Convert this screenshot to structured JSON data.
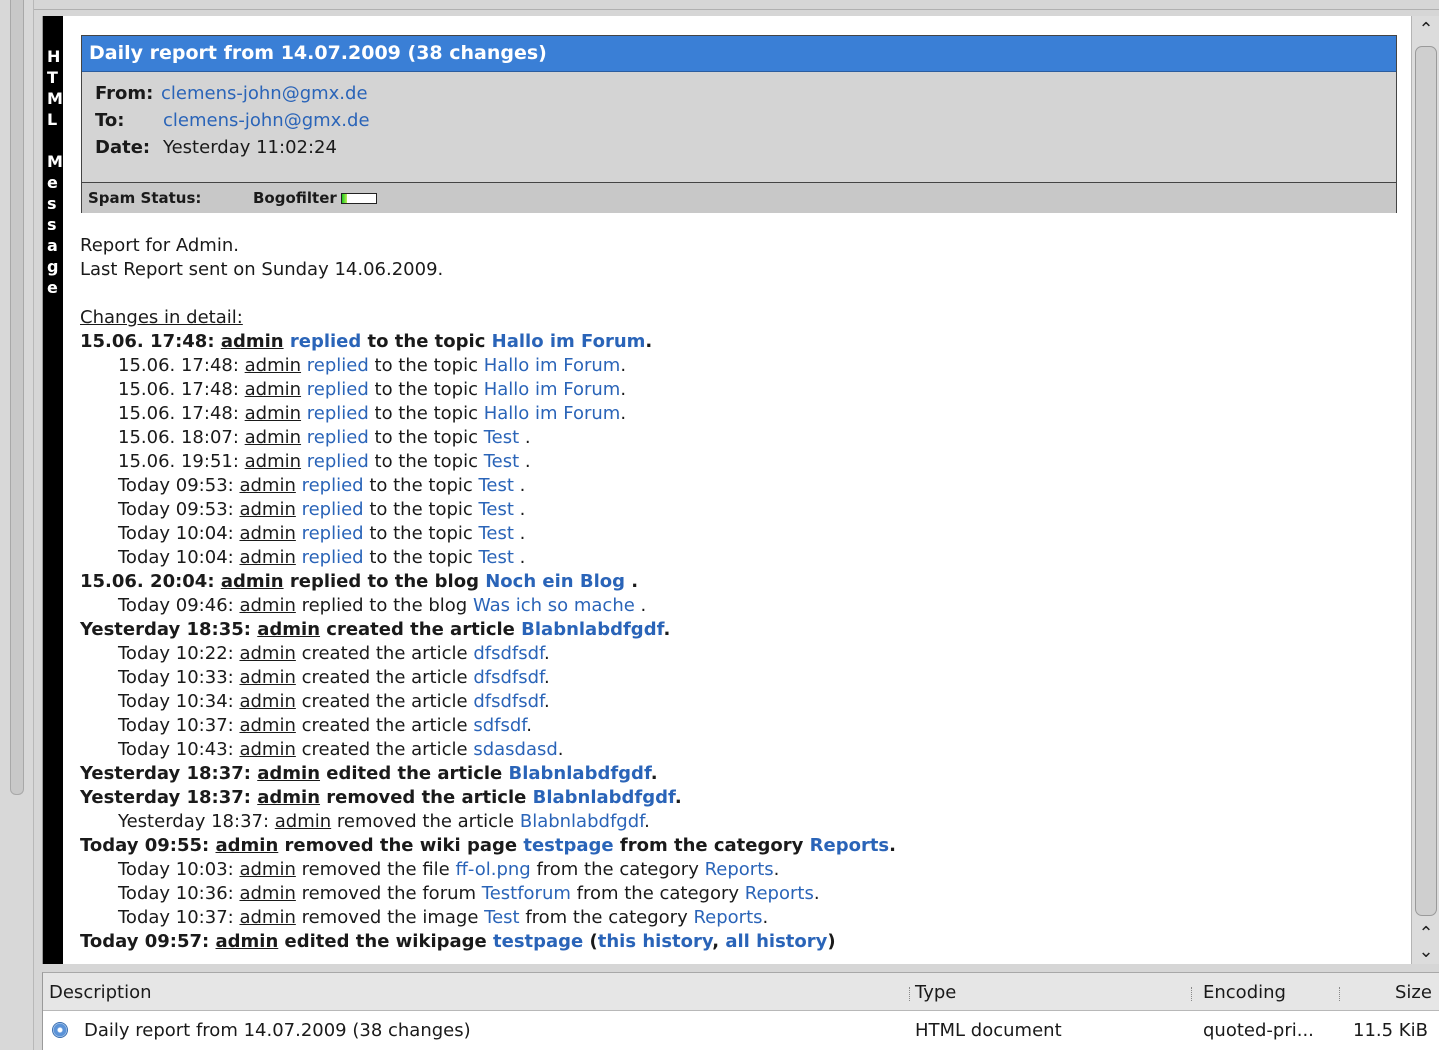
{
  "sidebar_label": "HTML Message",
  "header": {
    "title": "Daily report from 14.07.2009 (38 changes)",
    "from_label": "From:",
    "from_value": "clemens-john@gmx.de",
    "to_label": "To:",
    "to_value": "clemens-john@gmx.de",
    "date_label": "Date:",
    "date_value": "Yesterday 11:02:24",
    "spam_label": "Spam Status:",
    "spam_filter": "Bogofilter",
    "spam_level": 0.15
  },
  "body": {
    "line1": "Report for Admin.",
    "line2": "Last Report sent on Sunday 14.06.2009.",
    "changes_heading": "Changes in detail:"
  },
  "entries": [
    {
      "level": "main",
      "parts": [
        [
          "t",
          "15.06. 17:48: "
        ],
        [
          "u",
          "admin"
        ],
        [
          "t",
          " "
        ],
        [
          "l",
          "replied"
        ],
        [
          "t",
          " to the topic "
        ],
        [
          "l",
          "Hallo im Forum"
        ],
        [
          "t",
          "."
        ]
      ]
    },
    {
      "level": "sub",
      "parts": [
        [
          "t",
          "15.06. 17:48: "
        ],
        [
          "u",
          "admin"
        ],
        [
          "t",
          " "
        ],
        [
          "l",
          "replied"
        ],
        [
          "t",
          " to the topic "
        ],
        [
          "l",
          "Hallo im Forum"
        ],
        [
          "t",
          "."
        ]
      ]
    },
    {
      "level": "sub",
      "parts": [
        [
          "t",
          "15.06. 17:48: "
        ],
        [
          "u",
          "admin"
        ],
        [
          "t",
          " "
        ],
        [
          "l",
          "replied"
        ],
        [
          "t",
          " to the topic "
        ],
        [
          "l",
          "Hallo im Forum"
        ],
        [
          "t",
          "."
        ]
      ]
    },
    {
      "level": "sub",
      "parts": [
        [
          "t",
          "15.06. 17:48: "
        ],
        [
          "u",
          "admin"
        ],
        [
          "t",
          " "
        ],
        [
          "l",
          "replied"
        ],
        [
          "t",
          " to the topic "
        ],
        [
          "l",
          "Hallo im Forum"
        ],
        [
          "t",
          "."
        ]
      ]
    },
    {
      "level": "sub",
      "parts": [
        [
          "t",
          "15.06. 18:07: "
        ],
        [
          "u",
          "admin"
        ],
        [
          "t",
          " "
        ],
        [
          "l",
          "replied"
        ],
        [
          "t",
          " to the topic "
        ],
        [
          "l",
          "Test"
        ],
        [
          "t",
          " ."
        ]
      ]
    },
    {
      "level": "sub",
      "parts": [
        [
          "t",
          "15.06. 19:51: "
        ],
        [
          "u",
          "admin"
        ],
        [
          "t",
          " "
        ],
        [
          "l",
          "replied"
        ],
        [
          "t",
          " to the topic "
        ],
        [
          "l",
          "Test"
        ],
        [
          "t",
          " ."
        ]
      ]
    },
    {
      "level": "sub",
      "parts": [
        [
          "t",
          "Today 09:53: "
        ],
        [
          "u",
          "admin"
        ],
        [
          "t",
          " "
        ],
        [
          "l",
          "replied"
        ],
        [
          "t",
          " to the topic "
        ],
        [
          "l",
          "Test"
        ],
        [
          "t",
          " ."
        ]
      ]
    },
    {
      "level": "sub",
      "parts": [
        [
          "t",
          "Today 09:53: "
        ],
        [
          "u",
          "admin"
        ],
        [
          "t",
          " "
        ],
        [
          "l",
          "replied"
        ],
        [
          "t",
          " to the topic "
        ],
        [
          "l",
          "Test"
        ],
        [
          "t",
          " ."
        ]
      ]
    },
    {
      "level": "sub",
      "parts": [
        [
          "t",
          "Today 10:04: "
        ],
        [
          "u",
          "admin"
        ],
        [
          "t",
          " "
        ],
        [
          "l",
          "replied"
        ],
        [
          "t",
          " to the topic "
        ],
        [
          "l",
          "Test"
        ],
        [
          "t",
          " ."
        ]
      ]
    },
    {
      "level": "sub",
      "parts": [
        [
          "t",
          "Today 10:04: "
        ],
        [
          "u",
          "admin"
        ],
        [
          "t",
          " "
        ],
        [
          "l",
          "replied"
        ],
        [
          "t",
          " to the topic "
        ],
        [
          "l",
          "Test"
        ],
        [
          "t",
          " ."
        ]
      ]
    },
    {
      "level": "main",
      "parts": [
        [
          "t",
          "15.06. 20:04: "
        ],
        [
          "u",
          "admin"
        ],
        [
          "t",
          " replied to the blog "
        ],
        [
          "l",
          "Noch ein Blog"
        ],
        [
          "t",
          " ."
        ]
      ]
    },
    {
      "level": "sub",
      "parts": [
        [
          "t",
          "Today 09:46: "
        ],
        [
          "u",
          "admin"
        ],
        [
          "t",
          " replied to the blog "
        ],
        [
          "l",
          "Was ich so mache"
        ],
        [
          "t",
          " ."
        ]
      ]
    },
    {
      "level": "main",
      "parts": [
        [
          "t",
          "Yesterday 18:35: "
        ],
        [
          "u",
          "admin"
        ],
        [
          "t",
          " created the article "
        ],
        [
          "l",
          "Blabnlabdfgdf"
        ],
        [
          "t",
          "."
        ]
      ]
    },
    {
      "level": "sub",
      "parts": [
        [
          "t",
          "Today 10:22: "
        ],
        [
          "u",
          "admin"
        ],
        [
          "t",
          " created the article "
        ],
        [
          "l",
          "dfsdfsdf"
        ],
        [
          "t",
          "."
        ]
      ]
    },
    {
      "level": "sub",
      "parts": [
        [
          "t",
          "Today 10:33: "
        ],
        [
          "u",
          "admin"
        ],
        [
          "t",
          " created the article "
        ],
        [
          "l",
          "dfsdfsdf"
        ],
        [
          "t",
          "."
        ]
      ]
    },
    {
      "level": "sub",
      "parts": [
        [
          "t",
          "Today 10:34: "
        ],
        [
          "u",
          "admin"
        ],
        [
          "t",
          " created the article "
        ],
        [
          "l",
          "dfsdfsdf"
        ],
        [
          "t",
          "."
        ]
      ]
    },
    {
      "level": "sub",
      "parts": [
        [
          "t",
          "Today 10:37: "
        ],
        [
          "u",
          "admin"
        ],
        [
          "t",
          " created the article "
        ],
        [
          "l",
          "sdfsdf"
        ],
        [
          "t",
          "."
        ]
      ]
    },
    {
      "level": "sub",
      "parts": [
        [
          "t",
          "Today 10:43: "
        ],
        [
          "u",
          "admin"
        ],
        [
          "t",
          " created the article "
        ],
        [
          "l",
          "sdasdasd"
        ],
        [
          "t",
          "."
        ]
      ]
    },
    {
      "level": "main",
      "parts": [
        [
          "t",
          "Yesterday 18:37: "
        ],
        [
          "u",
          "admin"
        ],
        [
          "t",
          " edited the article "
        ],
        [
          "l",
          "Blabnlabdfgdf"
        ],
        [
          "t",
          "."
        ]
      ]
    },
    {
      "level": "main",
      "parts": [
        [
          "t",
          "Yesterday 18:37: "
        ],
        [
          "u",
          "admin"
        ],
        [
          "t",
          " removed the article "
        ],
        [
          "l",
          "Blabnlabdfgdf"
        ],
        [
          "t",
          "."
        ]
      ]
    },
    {
      "level": "sub",
      "parts": [
        [
          "t",
          "Yesterday 18:37: "
        ],
        [
          "u",
          "admin"
        ],
        [
          "t",
          " removed the article "
        ],
        [
          "l",
          "Blabnlabdfgdf"
        ],
        [
          "t",
          "."
        ]
      ]
    },
    {
      "level": "main",
      "parts": [
        [
          "t",
          "Today 09:55: "
        ],
        [
          "u",
          "admin"
        ],
        [
          "t",
          " removed the wiki page "
        ],
        [
          "l",
          "testpage"
        ],
        [
          "t",
          " from the category "
        ],
        [
          "l",
          "Reports"
        ],
        [
          "t",
          "."
        ]
      ]
    },
    {
      "level": "sub",
      "parts": [
        [
          "t",
          "Today 10:03: "
        ],
        [
          "u",
          "admin"
        ],
        [
          "t",
          " removed the file "
        ],
        [
          "l",
          "ff-ol.png"
        ],
        [
          "t",
          " from the category "
        ],
        [
          "l",
          "Reports"
        ],
        [
          "t",
          "."
        ]
      ]
    },
    {
      "level": "sub",
      "parts": [
        [
          "t",
          "Today 10:36: "
        ],
        [
          "u",
          "admin"
        ],
        [
          "t",
          " removed the forum "
        ],
        [
          "l",
          "Testforum"
        ],
        [
          "t",
          " from the category "
        ],
        [
          "l",
          "Reports"
        ],
        [
          "t",
          "."
        ]
      ]
    },
    {
      "level": "sub",
      "parts": [
        [
          "t",
          "Today 10:37: "
        ],
        [
          "u",
          "admin"
        ],
        [
          "t",
          " removed the image "
        ],
        [
          "l",
          "Test"
        ],
        [
          "t",
          " from the category "
        ],
        [
          "l",
          "Reports"
        ],
        [
          "t",
          "."
        ]
      ]
    },
    {
      "level": "main",
      "parts": [
        [
          "t",
          "Today 09:57: "
        ],
        [
          "u",
          "admin"
        ],
        [
          "t",
          " edited the wikipage "
        ],
        [
          "l",
          "testpage"
        ],
        [
          "t",
          " ("
        ],
        [
          "l",
          "this history"
        ],
        [
          "t",
          ", "
        ],
        [
          "l",
          "all history"
        ],
        [
          "t",
          ")"
        ]
      ]
    }
  ],
  "attachments": {
    "columns": {
      "description": "Description",
      "type": "Type",
      "encoding": "Encoding",
      "size": "Size"
    },
    "rows": [
      {
        "description": "Daily report from 14.07.2009 (38 changes)",
        "type": "HTML document",
        "encoding": "quoted-pri...",
        "size": "11.5 KiB"
      }
    ]
  },
  "colors": {
    "link": "#2a64b8",
    "title_bar": "#3a7fd6"
  }
}
